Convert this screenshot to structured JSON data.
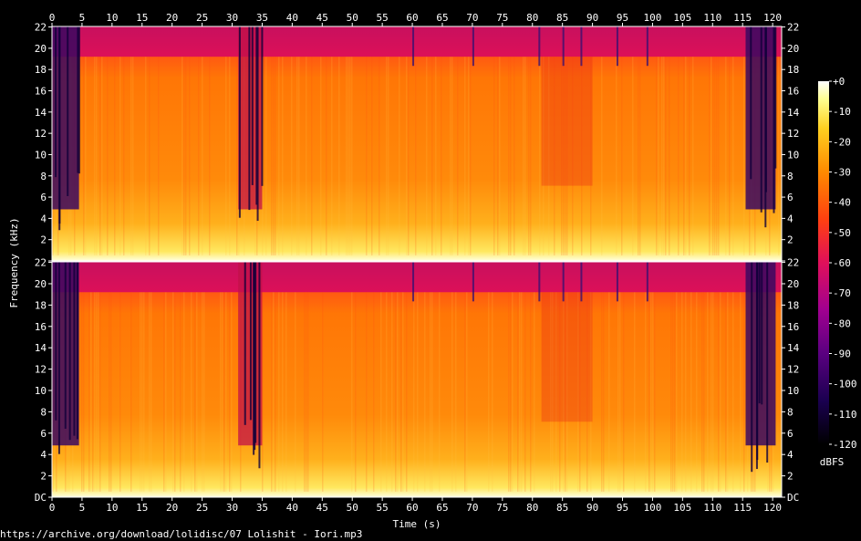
{
  "source_url": "https://archive.org/download/lolidisc/07 Lolishit - Iori.mp3",
  "chart_data": {
    "type": "heatmap",
    "subtype": "spectrogram",
    "channels": 2,
    "xlabel": "Time (s)",
    "ylabel": "Frequency (kHz)",
    "xlim": [
      0,
      121.5
    ],
    "x_ticks": [
      "0",
      "5",
      "10",
      "15",
      "20",
      "25",
      "30",
      "35",
      "40",
      "45",
      "50",
      "55",
      "60",
      "65",
      "70",
      "75",
      "80",
      "85",
      "90",
      "95",
      "100",
      "105",
      "110",
      "115",
      "120"
    ],
    "ylim_khz": [
      0,
      22.05
    ],
    "y_ticks": [
      "DC",
      "2",
      "4",
      "6",
      "8",
      "10",
      "12",
      "14",
      "16",
      "18",
      "20",
      "22"
    ],
    "colorbar": {
      "label": "dBFS",
      "range": [
        -120,
        0
      ],
      "ticks": [
        "+0",
        "-10",
        "-20",
        "-30",
        "-40",
        "-50",
        "-60",
        "-70",
        "-80",
        "-90",
        "-100",
        "-110",
        "-120"
      ]
    },
    "lowpass_cutoff_khz": 19.2,
    "dark_segments_s": [
      [
        0,
        4.5
      ],
      [
        31,
        35
      ],
      [
        115.5,
        120.5
      ]
    ],
    "colors": {
      "background": "#000000",
      "axis": "#ffffff",
      "ramp": [
        "#000000",
        "#1a0050",
        "#5a0080",
        "#a00090",
        "#e0105a",
        "#ff4010",
        "#ff8a00",
        "#ffd020",
        "#ffff90",
        "#ffffff"
      ]
    }
  }
}
